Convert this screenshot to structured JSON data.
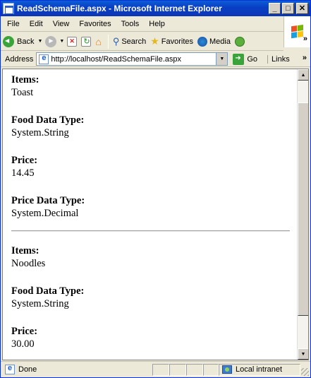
{
  "window": {
    "title": "ReadSchemaFile.aspx - Microsoft Internet Explorer",
    "controls": {
      "minimize": "_",
      "maximize": "□",
      "close": "✕"
    }
  },
  "menu": [
    "File",
    "Edit",
    "View",
    "Favorites",
    "Tools",
    "Help"
  ],
  "toolbar": {
    "back": "Back",
    "search": "Search",
    "favorites": "Favorites",
    "media": "Media",
    "overflow": "»"
  },
  "address": {
    "label": "Address",
    "url": "http://localhost/ReadSchemaFile.aspx",
    "go": "Go",
    "links": "Links",
    "overflow": "»"
  },
  "records": [
    {
      "items_label": "Items:",
      "items": "Toast",
      "food_type_label": "Food Data Type:",
      "food_type": "System.String",
      "price_label": "Price:",
      "price": "14.45",
      "price_type_label": "Price Data Type:",
      "price_type": "System.Decimal"
    },
    {
      "items_label": "Items:",
      "items": "Noodles",
      "food_type_label": "Food Data Type:",
      "food_type": "System.String",
      "price_label": "Price:",
      "price": "30.00"
    }
  ],
  "status": {
    "text": "Done",
    "zone": "Local intranet"
  },
  "icons": {
    "back": "back-arrow-icon",
    "forward": "forward-arrow-icon",
    "stop": "stop-icon",
    "refresh": "refresh-icon",
    "home": "home-icon",
    "search": "search-icon",
    "favorites": "star-icon",
    "media": "media-icon",
    "history": "history-icon",
    "go": "go-arrow-icon"
  },
  "colors": {
    "titlebar": "#0a46cc",
    "chrome": "#ece9d8"
  }
}
